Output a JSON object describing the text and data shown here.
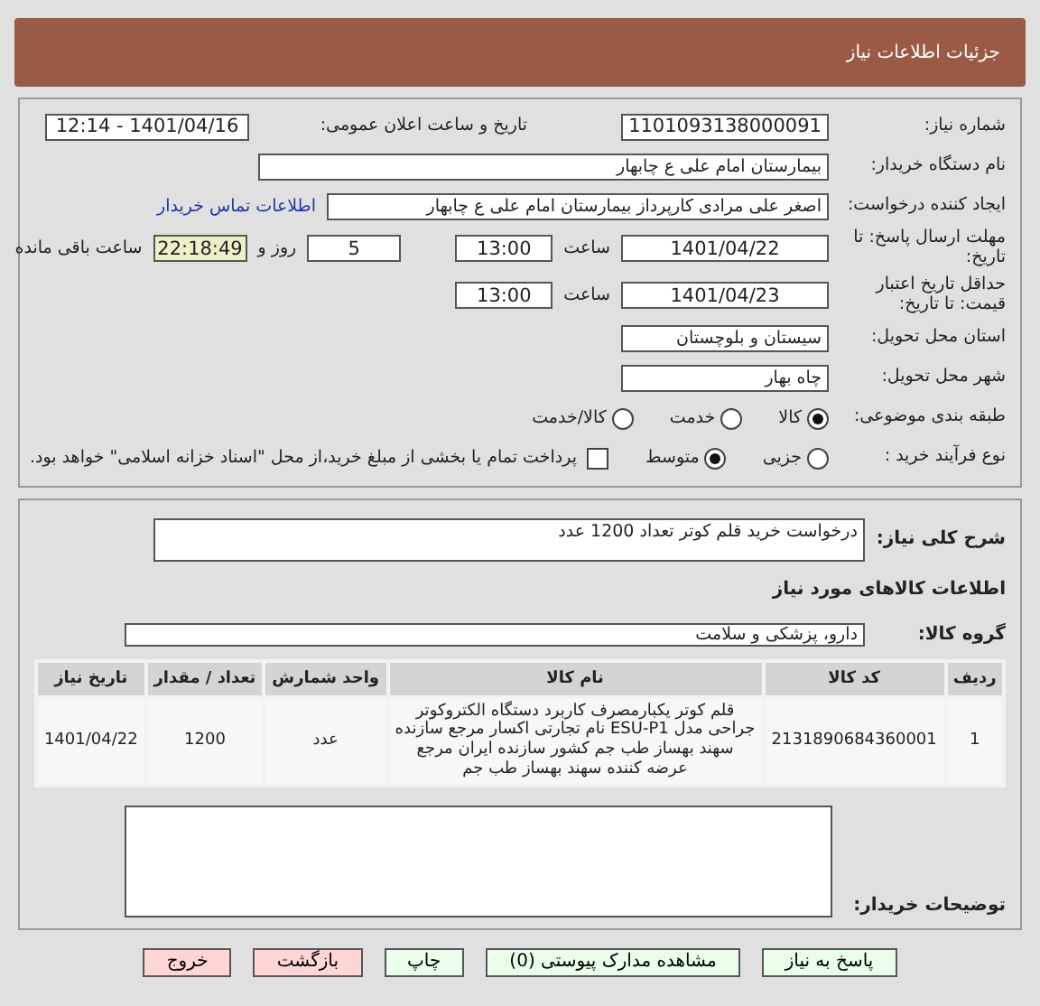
{
  "header": {
    "title": "جزئیات اطلاعات نیاز"
  },
  "need_number": {
    "label": "شماره نیاز:",
    "value": "1101093138000091"
  },
  "announce": {
    "label": "تاریخ و ساعت اعلان عمومی:",
    "value": "1401/04/16 - 12:14"
  },
  "buyer_org": {
    "label": "نام دستگاه خریدار:",
    "value": "بیمارستان امام علی  ع  چابهار"
  },
  "creator": {
    "label": "ایجاد کننده درخواست:",
    "value": "اصغر علی مرادی کارپرداز بیمارستان امام علی  ع  چابهار",
    "link": "اطلاعات تماس خریدار"
  },
  "deadline": {
    "label": "مهلت ارسال پاسخ: تا تاریخ:",
    "date": "1401/04/22",
    "time_label": "ساعت",
    "time": "13:00",
    "days": "5",
    "days_label": "روز و",
    "remaining": "22:18:49",
    "remaining_label": "ساعت باقی مانده"
  },
  "validity": {
    "label": "حداقل تاریخ اعتبار قیمت: تا تاریخ:",
    "date": "1401/04/23",
    "time_label": "ساعت",
    "time": "13:00"
  },
  "province": {
    "label": "استان محل تحویل:",
    "value": "سیستان و بلوچستان"
  },
  "city": {
    "label": "شهر محل تحویل:",
    "value": "چاه بهار"
  },
  "category": {
    "label": "طبقه بندی موضوعی:",
    "options": [
      {
        "label": "کالا",
        "selected": true
      },
      {
        "label": "خدمت",
        "selected": false
      },
      {
        "label": "کالا/خدمت",
        "selected": false
      }
    ]
  },
  "process": {
    "label": "نوع فرآیند خرید :",
    "options": [
      {
        "label": "جزیی",
        "selected": false
      },
      {
        "label": "متوسط",
        "selected": true
      }
    ],
    "payment": {
      "label": "پرداخت تمام یا بخشی از مبلغ خرید،از محل \"اسناد خزانه اسلامی\" خواهد بود.",
      "checked": false
    }
  },
  "description": {
    "label": "شرح کلی نیاز:",
    "value": "درخواست خرید قلم کوتر تعداد 1200 عدد"
  },
  "goods_heading": "اطلاعات کالاهای مورد نیاز",
  "goods_group": {
    "label": "گروه کالا:",
    "value": "دارو، پزشکی و سلامت"
  },
  "table": {
    "columns": [
      "ردیف",
      "کد کالا",
      "نام کالا",
      "واحد شمارش",
      "تعداد / مقدار",
      "تاریخ نیاز"
    ],
    "rows": [
      [
        "1",
        "2131890684360001",
        "قلم کوتر یکبارمصرف کاربرد دستگاه الکتروکوتر جراحی مدل ESU-P1 نام تجارتی اکسار مرجع سازنده سهند بهساز طب جم کشور سازنده ایران مرجع عرضه کننده سهند بهساز طب جم",
        "عدد",
        "1200",
        "1401/04/22"
      ]
    ]
  },
  "buyer_notes": {
    "label": "توضیحات خریدار:"
  },
  "buttons": [
    {
      "label": "پاسخ به نیاز",
      "kind": "primary"
    },
    {
      "label": "مشاهده مدارک پیوستی (0)",
      "kind": "primary"
    },
    {
      "label": "چاپ",
      "kind": "primary"
    },
    {
      "label": "بازگشت",
      "kind": "danger"
    },
    {
      "label": "خروج",
      "kind": "danger"
    }
  ]
}
